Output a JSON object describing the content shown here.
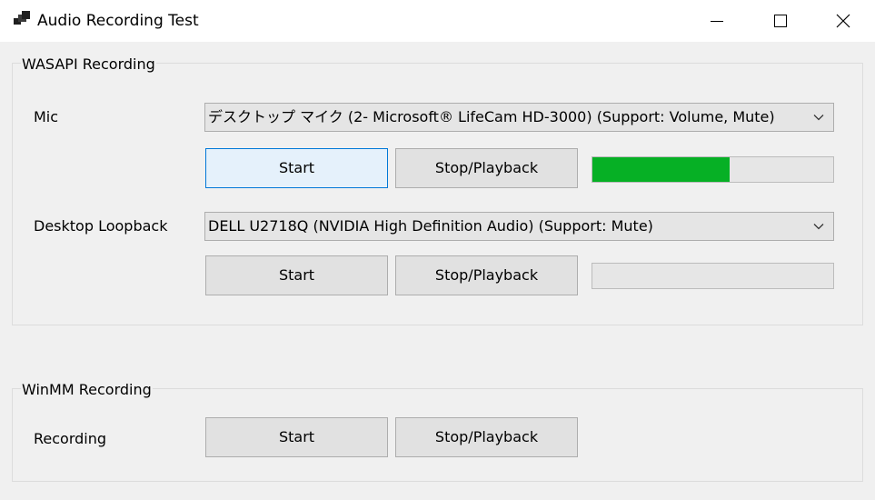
{
  "window": {
    "title": "Audio Recording Test",
    "icon": "app-window-icon",
    "controls": [
      "minimize-icon",
      "maximize-icon",
      "close-icon"
    ]
  },
  "wasapi": {
    "legend": "WASAPI Recording",
    "mic": {
      "label": "Mic",
      "device": "デスクトップ マイク (2- Microsoft® LifeCam HD-3000) (Support: Volume, Mute)",
      "start_label": "Start",
      "stop_label": "Stop/Playback",
      "level": 0.57
    },
    "loopback": {
      "label": "Desktop Loopback",
      "device": "DELL U2718Q (NVIDIA High Definition Audio) (Support: Mute)",
      "start_label": "Start",
      "stop_label": "Stop/Playback",
      "level": 0
    }
  },
  "winmm": {
    "legend": "WinMM Recording",
    "recording": {
      "label": "Recording",
      "start_label": "Start",
      "stop_label": "Stop/Playback"
    }
  },
  "colors": {
    "level_fill": "#06b025",
    "focus_border": "#0078d7"
  }
}
